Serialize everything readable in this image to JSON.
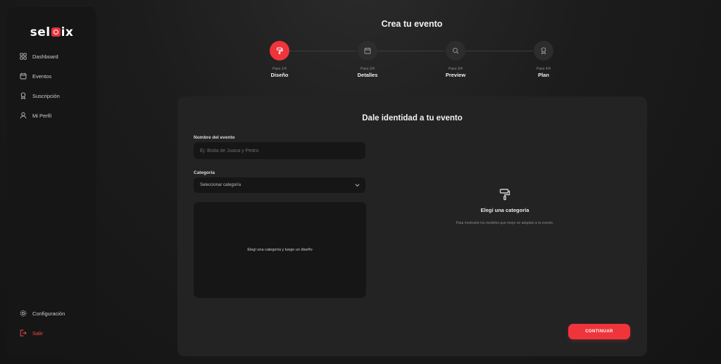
{
  "brand": {
    "prefix": "sel",
    "suffix": "ix",
    "accent": "#f0343c"
  },
  "sidebar": {
    "items": [
      {
        "label": "Dashboard",
        "icon": "dashboard-grid-icon"
      },
      {
        "label": "Eventos",
        "icon": "calendar-icon"
      },
      {
        "label": "Suscripción",
        "icon": "award-icon"
      },
      {
        "label": "Mi Perfil",
        "icon": "user-icon"
      }
    ],
    "settings": {
      "label": "Configuración",
      "icon": "gear-icon"
    },
    "logout": {
      "label": "Salir",
      "icon": "logout-icon",
      "color": "#ff4a4a"
    }
  },
  "header": {
    "title": "Crea tu evento"
  },
  "stepper": {
    "steps": [
      {
        "number": "Paso 1/4",
        "label": "Diseño",
        "icon": "paint-roller-icon",
        "active": true
      },
      {
        "number": "Paso 2/4",
        "label": "Detalles",
        "icon": "calendar-icon",
        "active": false
      },
      {
        "number": "Paso 3/4",
        "label": "Preview",
        "icon": "search-icon",
        "active": false
      },
      {
        "number": "Paso 4/4",
        "label": "Plan",
        "icon": "award-icon",
        "active": false
      }
    ]
  },
  "form": {
    "title": "Dale identidad a tu evento",
    "name_label": "Nombre del evento",
    "name_value": "",
    "name_placeholder": "Ej: Boda de Juana y Pedro",
    "category_label": "Categoría",
    "category_selected": "Seleccionar categoría",
    "design_hint": "Elegí una categoría y luego un diseño"
  },
  "preview": {
    "icon": "paint-roller-icon",
    "title": "Elegí una categoría",
    "text": "Para mostrarte los modelos que mejor se adaptan a tu evento."
  },
  "actions": {
    "continue_label": "CONTINUAR"
  }
}
